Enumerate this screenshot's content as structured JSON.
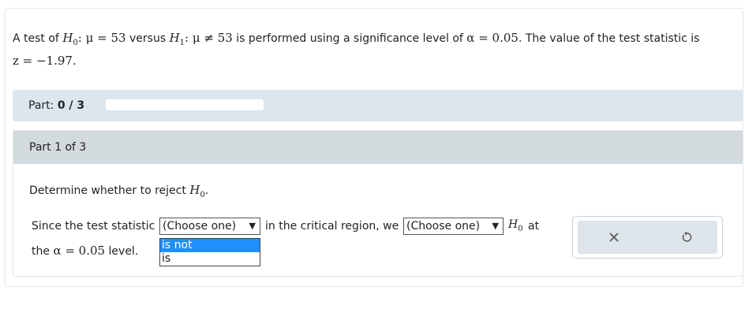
{
  "question": {
    "intro": "A test of",
    "h0_expr": ": μ = 53",
    "versus": "versus",
    "h1_expr": ": μ ≠ 53",
    "middle": "is performed using a significance level of",
    "alpha_expr": "α = 0.05",
    "tail": ". The value of the test statistic is",
    "z_expr": "z = −1.97."
  },
  "part_progress": {
    "label": "Part:",
    "value": "0 / 3",
    "fraction": 0.0
  },
  "panel": {
    "title": "Part 1 of 3",
    "instruction": "Determine whether to reject",
    "instruction_end": ".",
    "sentence_start": "Since the test statistic",
    "select1_value": "(Choose one)",
    "sentence_mid": "in the critical region, we",
    "select2_value": "(Choose one)",
    "sentence_at": "at",
    "sentence_level_prefix": "the",
    "alpha_expr": "α = 0.05",
    "sentence_level_suffix": "level."
  },
  "dropdown_options": [
    "is not",
    "is"
  ],
  "icons": {
    "clear": "close-icon",
    "reset": "undo-icon"
  }
}
